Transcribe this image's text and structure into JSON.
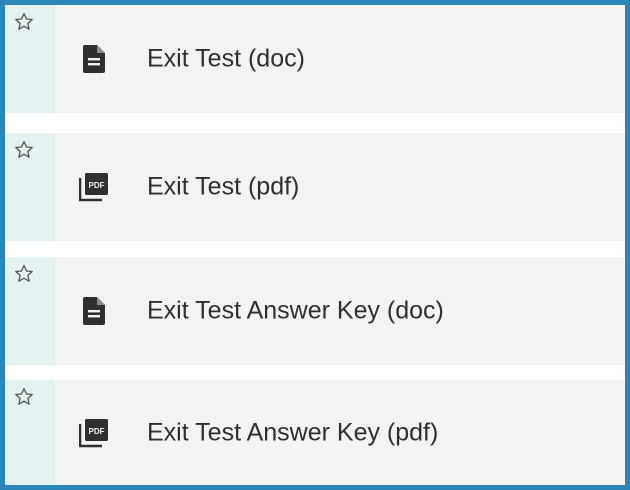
{
  "resources": [
    {
      "label": "Exit Test (doc)",
      "file_icon": "document-icon",
      "favorite_icon": "star-outline-icon"
    },
    {
      "label": "Exit Test (pdf)",
      "file_icon": "pdf-icon",
      "favorite_icon": "star-outline-icon"
    },
    {
      "label": "Exit Test Answer Key (doc)",
      "file_icon": "document-icon",
      "favorite_icon": "star-outline-icon"
    },
    {
      "label": "Exit Test Answer Key (pdf)",
      "file_icon": "pdf-icon",
      "favorite_icon": "star-outline-icon"
    }
  ],
  "pdf_icon_text": "PDF",
  "colors": {
    "border": "#2c86b7",
    "favorite_column": "#e5f2f2",
    "row_background": "#f3f3f3",
    "text": "#2f2f2f",
    "icon": "#2f2f2f"
  }
}
